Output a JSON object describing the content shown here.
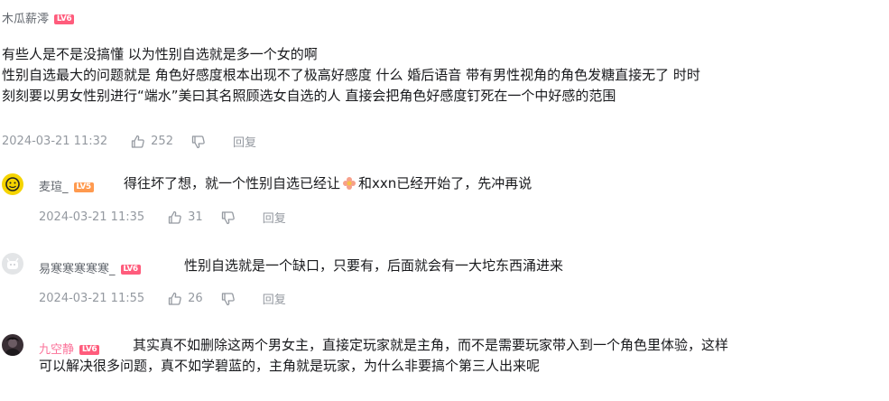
{
  "comments": [
    {
      "username": "木瓜薪澪",
      "level": "LV6",
      "lines": [
        "有些人是不是没搞懂 以为性别自选就是多一个女的啊",
        "性别自选最大的问题就是 角色好感度根本出现不了极高好感度 什么 婚后语音  带有男性视角的角色发糖直接无了 时时",
        "刻刻要以男女性别进行“端水”美曰其名照顾选女自选的人 直接会把角色好感度钉死在一个中好感的范围"
      ],
      "time": "2024-03-21 11:32",
      "likes": "252",
      "reply": "回复"
    },
    {
      "username": "麦瑄_",
      "level": "LV5",
      "text_before": "得往坏了想，就一个性别自选已经让",
      "text_after": "和xxn已经开始了，先冲再说",
      "time": "2024-03-21 11:35",
      "likes": "31",
      "reply": "回复"
    },
    {
      "username": "易寒寒寒寒寒_",
      "level": "LV6",
      "text": "性别自选就是一个缺口，只要有，后面就会有一大坨东西涌进来",
      "time": "2024-03-21 11:55",
      "likes": "26",
      "reply": "回复"
    },
    {
      "username": "九空静",
      "level": "LV6",
      "lines": [
        "其实真不如删除这两个男女主，直接定玩家就是主角，而不是需要玩家带入到一个角色里体验，这样",
        "可以解决很多问题，真不如学碧蓝的，主角就是玩家，为什么非要搞个第三人出来呢"
      ]
    }
  ],
  "colors": {
    "pink_name": "#fb7299",
    "level6": "#ff5c7c",
    "level5": "#ff9a4f",
    "meta_text": "#9499a0"
  },
  "icons": [
    "thumb-up-icon",
    "thumb-down-icon",
    "flower-emoji-icon"
  ]
}
